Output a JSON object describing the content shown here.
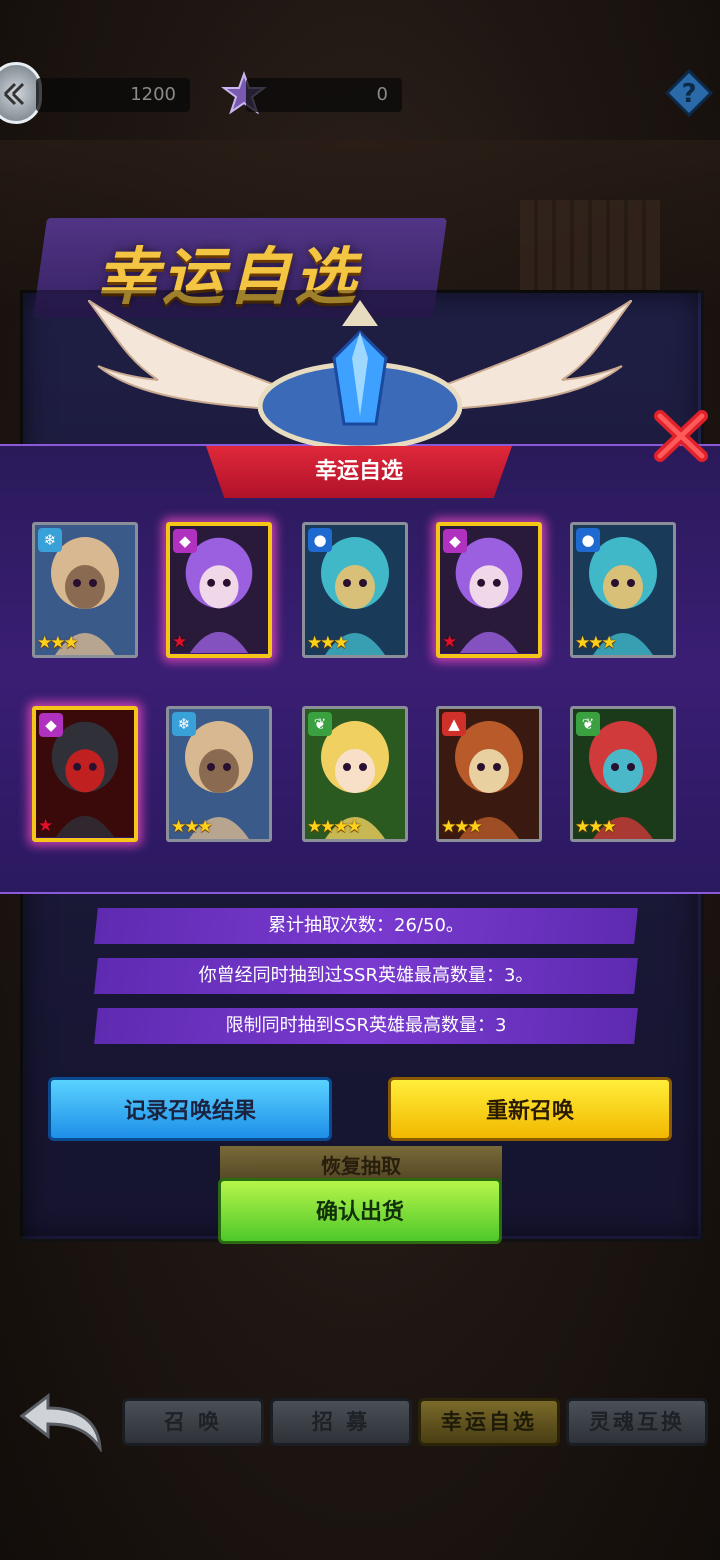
{
  "top_bar": {
    "gem_count": "1200",
    "star_count": "0"
  },
  "banner_title": "幸运自选",
  "overlay": {
    "ribbon_title": "幸运自选"
  },
  "cards": [
    {
      "element": "ice",
      "stars": 3,
      "star_color": "gold",
      "highlight": false,
      "hero": "horned-beast-hero"
    },
    {
      "element": "dark",
      "stars": 1,
      "star_color": "red",
      "highlight": true,
      "hero": "purple-hair-girl"
    },
    {
      "element": "water",
      "stars": 3,
      "star_color": "gold",
      "highlight": false,
      "hero": "masked-water-warrior"
    },
    {
      "element": "dark",
      "stars": 1,
      "star_color": "red",
      "highlight": true,
      "hero": "purple-hair-girl"
    },
    {
      "element": "water",
      "stars": 3,
      "star_color": "gold",
      "highlight": false,
      "hero": "masked-water-warrior"
    },
    {
      "element": "dark",
      "stars": 1,
      "star_color": "red",
      "highlight": true,
      "hero": "dark-armored-vampire"
    },
    {
      "element": "ice",
      "stars": 3,
      "star_color": "gold",
      "highlight": false,
      "hero": "horned-beast-hero"
    },
    {
      "element": "nature",
      "stars": 4,
      "star_color": "gold",
      "highlight": false,
      "hero": "blonde-girl"
    },
    {
      "element": "fire",
      "stars": 3,
      "star_color": "gold",
      "highlight": false,
      "hero": "minotaur"
    },
    {
      "element": "nature",
      "stars": 3,
      "star_color": "gold",
      "highlight": false,
      "hero": "mushroom-creature"
    }
  ],
  "info": {
    "line1": "累计抽取次数：26/50。",
    "line2": "你曾经同时抽到过SSR英雄最高数量：3。",
    "line3": "限制同时抽到SSR英雄最高数量：3"
  },
  "buttons": {
    "record": "记录召唤结果",
    "resummon": "重新召唤",
    "restore": "恢复抽取",
    "confirm": "确认出货"
  },
  "nav_tabs": [
    "召 唤",
    "招 募",
    "幸运自选",
    "灵魂互换"
  ],
  "colors": {
    "accent_purple": "#7a3ad0",
    "ribbon_red": "#d0202e",
    "gold": "#f5c518"
  }
}
